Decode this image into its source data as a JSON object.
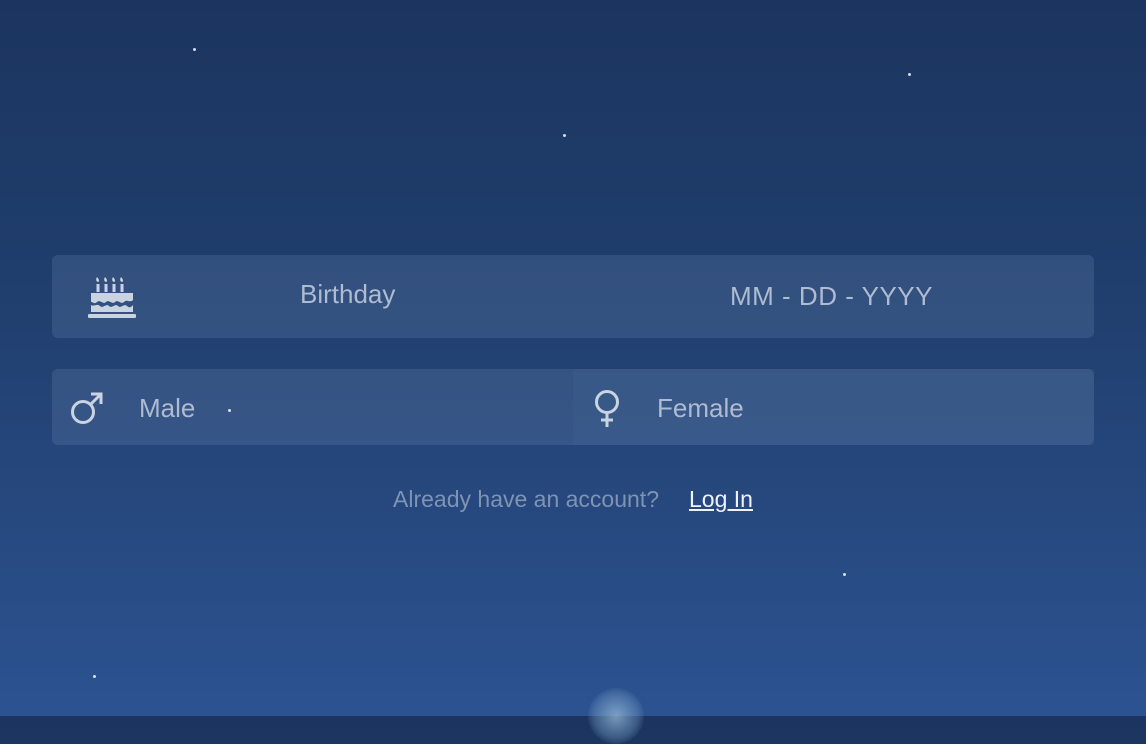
{
  "colors": {
    "background_top": "#1c3560",
    "background_bottom": "#2c5391",
    "panel": "#3a5482",
    "label_text": "#aebbd1",
    "prompt_text": "#7f93b2",
    "link_text": "#eef3fb"
  },
  "birthday": {
    "icon": "birthday-cake-icon",
    "label": "Birthday",
    "value": "MM - DD - YYYY"
  },
  "gender": {
    "male": {
      "icon": "male-symbol-icon",
      "label": "Male"
    },
    "female": {
      "icon": "female-symbol-icon",
      "label": "Female"
    }
  },
  "account": {
    "prompt": "Already have an account?",
    "login_label": "Log In"
  }
}
